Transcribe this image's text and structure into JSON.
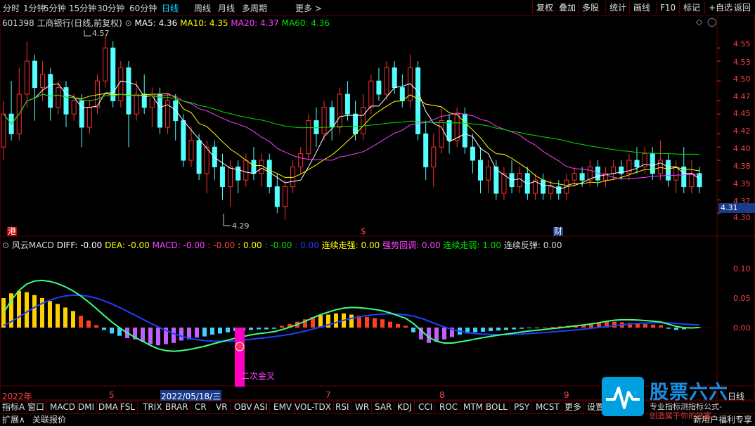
{
  "toolbar": {
    "periods": [
      "分时",
      "1分钟",
      "5分钟",
      "15分钟",
      "30分钟",
      "60分钟",
      "日线",
      "周线",
      "月线",
      "多周期",
      "更多 >"
    ],
    "active_period": "日线",
    "right_buttons": [
      "复权",
      "叠加",
      "多股",
      "统计",
      "画线",
      "F10",
      "标记",
      "+自选",
      "返回"
    ]
  },
  "main_info": {
    "stock": "601398 工商银行(日线,前复权)",
    "ma5": "MA5: 4.36",
    "ma10": "MA10: 4.35",
    "ma20": "MA20: 4.37",
    "ma60": "MA60: 4.36"
  },
  "price_axis": {
    "ticks": [
      "4.55",
      "4.53",
      "4.50",
      "4.47",
      "4.45",
      "4.42",
      "4.40",
      "4.38",
      "4.35",
      "4.32",
      "4.30"
    ],
    "current": "4.31"
  },
  "annotations": {
    "high": "4.57",
    "low": "4.29",
    "mark_gang": "港",
    "mark_dollar": "$",
    "mark_cai": "财",
    "cross_label": "二次金叉"
  },
  "indicator_info": {
    "name": "风云MACD",
    "diff": "DIFF: -0.00",
    "dea": "DEA: -0.00",
    "macd": "MACD: -0.00",
    "v1": ": -0.00",
    "v2": ": 0.00",
    "v3": ": -0.00",
    "v4": ": 0.00",
    "strong": "连续走强: 0.00",
    "pullback": "强势回调: 0.00",
    "weak": "连续走弱: 1.00",
    "rebound": "连续反弹: 0.00"
  },
  "indicator_axis": {
    "ticks": [
      "0.10",
      "0.05",
      "0.00"
    ]
  },
  "time_axis": {
    "labels": [
      "2022年",
      "5",
      "2022/05/18/三",
      "7",
      "8",
      "9",
      "日线"
    ]
  },
  "tabs": [
    "指标A",
    "窗口",
    "MACD",
    "DMI",
    "DMA",
    "FSL",
    "TRIX",
    "BRAR",
    "CR",
    "VR",
    "OBV",
    "ASI",
    "EMV",
    "VOL-TDX",
    "RSI",
    "WR",
    "SAR",
    "KDJ",
    "CCI",
    "ROC",
    "MTM",
    "BOLL",
    "PSY",
    "MCST",
    "更多",
    "设置"
  ],
  "status": {
    "expand": "扩展∧",
    "linked": "关联报价",
    "right": "新用户福利专享"
  },
  "logo": {
    "name": "股票六六",
    "sub": "专业指标测指标公式-",
    "sub2": "创造属于你的财富"
  },
  "colors": {
    "up": "#ff3030",
    "down": "#54ffff",
    "ma5": "#ffffff",
    "ma10": "#ffff00",
    "ma20": "#ff40ff",
    "ma60": "#00e000",
    "grid": "#6a0000"
  },
  "chart_data": {
    "type": "candlestick",
    "ylim": [
      4.28,
      4.58
    ],
    "candles": [
      [
        4.4,
        4.45,
        4.47,
        4.38
      ],
      [
        4.45,
        4.42,
        4.5,
        4.41
      ],
      [
        4.42,
        4.48,
        4.52,
        4.41
      ],
      [
        4.48,
        4.53,
        4.56,
        4.46
      ],
      [
        4.53,
        4.49,
        4.54,
        4.44
      ],
      [
        4.49,
        4.51,
        4.53,
        4.47
      ],
      [
        4.51,
        4.46,
        4.52,
        4.44
      ],
      [
        4.46,
        4.49,
        4.5,
        4.45
      ],
      [
        4.49,
        4.45,
        4.5,
        4.43
      ],
      [
        4.45,
        4.47,
        4.48,
        4.44
      ],
      [
        4.47,
        4.43,
        4.48,
        4.4
      ],
      [
        4.43,
        4.46,
        4.47,
        4.42
      ],
      [
        4.46,
        4.5,
        4.51,
        4.45
      ],
      [
        4.5,
        4.55,
        4.57,
        4.49
      ],
      [
        4.55,
        4.47,
        4.56,
        4.46
      ],
      [
        4.47,
        4.52,
        4.53,
        4.46
      ],
      [
        4.52,
        4.45,
        4.53,
        4.4
      ],
      [
        4.45,
        4.48,
        4.5,
        4.44
      ],
      [
        4.48,
        4.46,
        4.51,
        4.45
      ],
      [
        4.46,
        4.48,
        4.49,
        4.43
      ],
      [
        4.48,
        4.43,
        4.49,
        4.42
      ],
      [
        4.43,
        4.47,
        4.48,
        4.42
      ],
      [
        4.47,
        4.44,
        4.48,
        4.41
      ],
      [
        4.44,
        4.38,
        4.45,
        4.37
      ],
      [
        4.38,
        4.41,
        4.43,
        4.37
      ],
      [
        4.41,
        4.36,
        4.42,
        4.35
      ],
      [
        4.36,
        4.4,
        4.41,
        4.33
      ],
      [
        4.4,
        4.37,
        4.41,
        4.35
      ],
      [
        4.37,
        4.34,
        4.39,
        4.32
      ],
      [
        4.34,
        4.37,
        4.38,
        4.31
      ],
      [
        4.37,
        4.35,
        4.38,
        4.33
      ],
      [
        4.35,
        4.38,
        4.39,
        4.34
      ],
      [
        4.38,
        4.36,
        4.4,
        4.35
      ],
      [
        4.36,
        4.38,
        4.39,
        4.34
      ],
      [
        4.38,
        4.34,
        4.39,
        4.33
      ],
      [
        4.34,
        4.31,
        4.36,
        4.3
      ],
      [
        4.31,
        4.34,
        4.35,
        4.29
      ],
      [
        4.34,
        4.37,
        4.38,
        4.33
      ],
      [
        4.37,
        4.39,
        4.4,
        4.36
      ],
      [
        4.39,
        4.44,
        4.45,
        4.38
      ],
      [
        4.44,
        4.42,
        4.46,
        4.4
      ],
      [
        4.42,
        4.46,
        4.47,
        4.41
      ],
      [
        4.46,
        4.43,
        4.47,
        4.41
      ],
      [
        4.43,
        4.48,
        4.49,
        4.42
      ],
      [
        4.48,
        4.45,
        4.5,
        4.44
      ],
      [
        4.45,
        4.42,
        4.47,
        4.41
      ],
      [
        4.42,
        4.46,
        4.48,
        4.41
      ],
      [
        4.46,
        4.5,
        4.51,
        4.45
      ],
      [
        4.5,
        4.48,
        4.52,
        4.47
      ],
      [
        4.48,
        4.52,
        4.53,
        4.47
      ],
      [
        4.52,
        4.49,
        4.53,
        4.48
      ],
      [
        4.49,
        4.47,
        4.51,
        4.46
      ],
      [
        4.47,
        4.52,
        4.54,
        4.46
      ],
      [
        4.52,
        4.42,
        4.53,
        4.41
      ],
      [
        4.42,
        4.37,
        4.44,
        4.35
      ],
      [
        4.37,
        4.4,
        4.42,
        4.34
      ],
      [
        4.4,
        4.44,
        4.46,
        4.39
      ],
      [
        4.44,
        4.41,
        4.45,
        4.39
      ],
      [
        4.41,
        4.45,
        4.46,
        4.4
      ],
      [
        4.45,
        4.4,
        4.46,
        4.39
      ],
      [
        4.4,
        4.38,
        4.42,
        4.36
      ],
      [
        4.38,
        4.35,
        4.4,
        4.33
      ],
      [
        4.35,
        4.37,
        4.38,
        4.33
      ],
      [
        4.37,
        4.33,
        4.38,
        4.32
      ],
      [
        4.33,
        4.36,
        4.37,
        4.32
      ],
      [
        4.36,
        4.34,
        4.38,
        4.33
      ],
      [
        4.34,
        4.36,
        4.37,
        4.33
      ],
      [
        4.36,
        4.33,
        4.37,
        4.32
      ],
      [
        4.33,
        4.35,
        4.36,
        4.32
      ],
      [
        4.35,
        4.33,
        4.36,
        4.32
      ],
      [
        4.33,
        4.34,
        4.35,
        4.32
      ],
      [
        4.34,
        4.33,
        4.35,
        4.32
      ],
      [
        4.33,
        4.35,
        4.36,
        4.32
      ],
      [
        4.35,
        4.36,
        4.37,
        4.34
      ],
      [
        4.36,
        4.35,
        4.37,
        4.34
      ],
      [
        4.35,
        4.37,
        4.38,
        4.34
      ],
      [
        4.37,
        4.35,
        4.38,
        4.34
      ],
      [
        4.35,
        4.36,
        4.37,
        4.34
      ],
      [
        4.36,
        4.37,
        4.38,
        4.35
      ],
      [
        4.37,
        4.36,
        4.38,
        4.35
      ],
      [
        4.36,
        4.38,
        4.39,
        4.35
      ],
      [
        4.38,
        4.37,
        4.4,
        4.36
      ],
      [
        4.37,
        4.39,
        4.4,
        4.36
      ],
      [
        4.39,
        4.36,
        4.4,
        4.35
      ],
      [
        4.36,
        4.38,
        4.41,
        4.35
      ],
      [
        4.38,
        4.35,
        4.39,
        4.34
      ],
      [
        4.35,
        4.37,
        4.38,
        4.33
      ],
      [
        4.37,
        4.34,
        4.4,
        4.33
      ],
      [
        4.34,
        4.36,
        4.38,
        4.33
      ],
      [
        4.36,
        4.34,
        4.37,
        4.33
      ]
    ],
    "macd_hist": [
      0.05,
      0.058,
      0.062,
      0.06,
      0.055,
      0.05,
      0.045,
      0.04,
      0.034,
      0.028,
      0.02,
      0.012,
      0.004,
      -0.004,
      -0.01,
      -0.014,
      -0.018,
      -0.02,
      -0.024,
      -0.028,
      -0.03,
      -0.028,
      -0.026,
      -0.022,
      -0.02,
      -0.017,
      -0.015,
      -0.012,
      -0.01,
      -0.008,
      -0.006,
      -0.005,
      -0.004,
      -0.003,
      -0.003,
      -0.002,
      0.003,
      0.006,
      0.01,
      0.014,
      0.018,
      0.021,
      0.022,
      0.024,
      0.024,
      0.022,
      0.02,
      0.018,
      0.016,
      0.014,
      0.01,
      0.006,
      0.003,
      -0.008,
      -0.02,
      -0.026,
      -0.024,
      -0.02,
      -0.016,
      -0.012,
      -0.01,
      -0.008,
      -0.007,
      -0.006,
      -0.005,
      -0.004,
      -0.003,
      -0.002,
      -0.001,
      -0.001,
      0.0,
      0.001,
      0.002,
      0.003,
      0.004,
      0.005,
      0.006,
      0.008,
      0.01,
      0.01,
      0.009,
      0.008,
      0.007,
      0.006,
      0.005,
      0.004,
      -0.002,
      -0.004,
      -0.003,
      -0.001,
      0.001
    ]
  }
}
